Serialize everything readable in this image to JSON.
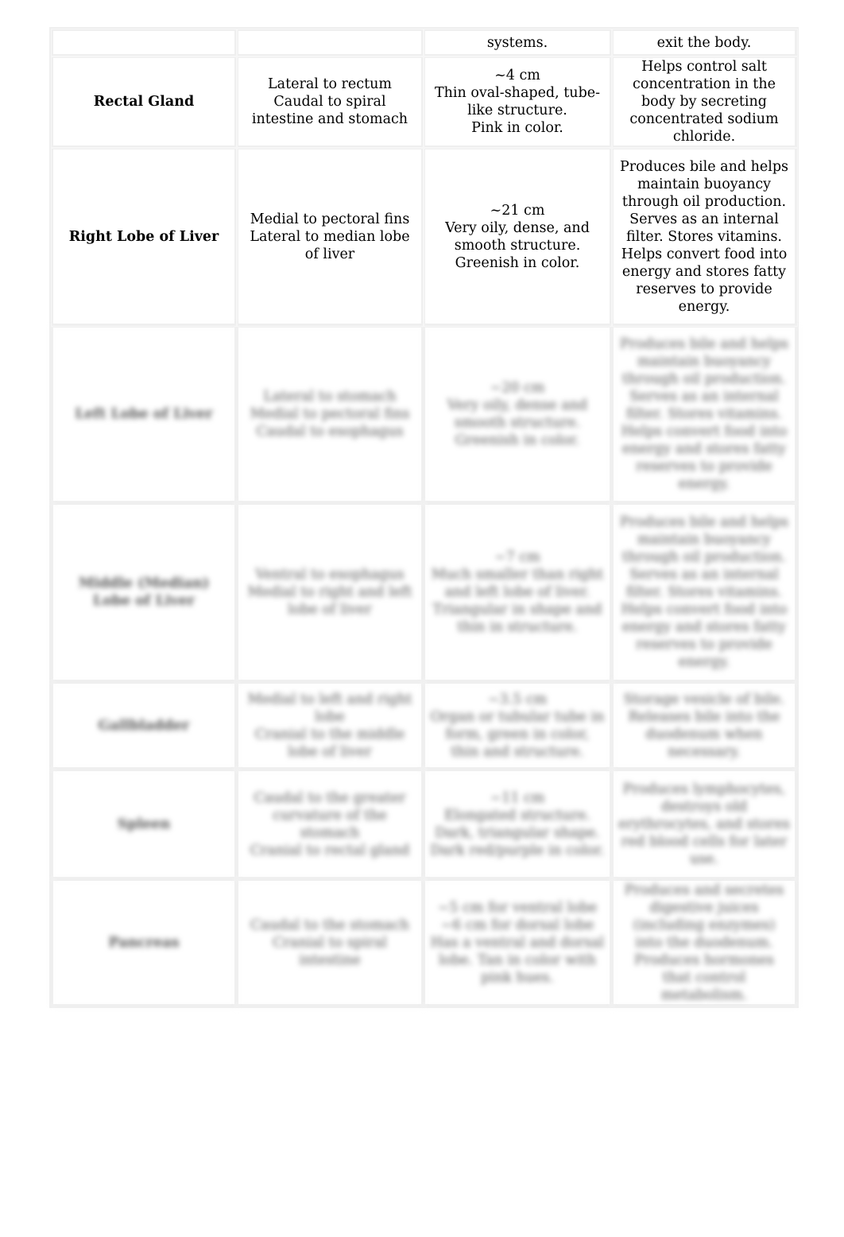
{
  "table": {
    "rows": [
      {
        "structure": "",
        "location": "",
        "description": "systems.",
        "function": "exit the body.",
        "height": 34,
        "blurred": false
      },
      {
        "structure": "Rectal Gland",
        "location": "Lateral to rectum\nCaudal to spiral intestine and stomach",
        "description": "~4 cm\nThin oval-shaped, tube-like structure.\nPink in color.",
        "function": "Helps control salt concentration in the body by secreting concentrated sodium chloride.",
        "height": 100,
        "blurred": false
      },
      {
        "structure": "Right Lobe of Liver",
        "location": "Medial to pectoral fins\nLateral to median lobe of liver",
        "description": "~21 cm\nVery oily, dense, and smooth structure.\nGreenish in color.",
        "function": "Produces bile and helps maintain buoyancy through oil production. Serves as an internal filter. Stores vitamins. Helps convert food into energy and stores fatty reserves to provide energy.",
        "height": 224,
        "blurred": false
      },
      {
        "structure": "Left Lobe of Liver",
        "location": "Lateral to stomach\nMedial to pectoral fins\nCaudal to esophagus",
        "description": "~20 cm\nVery oily, dense and smooth structure.\nGreenish in color.",
        "function": "Produces bile and helps maintain buoyancy through oil production. Serves as an internal filter. Stores vitamins. Helps convert food into energy and stores fatty reserves to provide energy.",
        "height": 223,
        "blurred": true
      },
      {
        "structure": "Middle (Median) Lobe of Liver",
        "location": "Ventral to esophagus\nMedial to right and left lobe of liver",
        "description": "~7 cm\nMuch smaller than right and left lobe of liver. Triangular in shape and thin in structure.",
        "function": "Produces bile and helps maintain buoyancy through oil production. Serves as an internal filter. Stores vitamins. Helps convert food into energy and stores fatty reserves to provide energy.",
        "height": 225,
        "blurred": true
      },
      {
        "structure": "Gallbladder",
        "location": "Medial to left and right lobe\nCranial to the middle lobe of liver",
        "description": "~3.5 cm\nOrgan or tubular tube in form, green in color, thin and structure.",
        "function": "Storage vesicle of bile. Releases bile into the duodenum when necessary.",
        "height": 110,
        "blurred": true
      },
      {
        "structure": "Spleen",
        "location": "Caudal to the greater curvature of the stomach\nCranial to rectal gland",
        "description": "~11 cm\nElongated structure. Dark, triangular shape. Dark red/purple in color.",
        "function": "Produces lymphocytes, destroys old erythrocytes, and stores red blood cells for later use.",
        "height": 138,
        "blurred": true
      },
      {
        "structure": "Pancreas",
        "location": "Caudal to the stomach\nCranial to spiral intestine",
        "description": "~5 cm for ventral lobe\n~6 cm for dorsal lobe\nHas a ventral and dorsal lobe. Tan in color with pink hues.",
        "function": "Produces and secretes digestive juices (including enzymes) into the duodenum. Produces hormones that control metabolism.",
        "height": 160,
        "blurred": true
      }
    ]
  }
}
